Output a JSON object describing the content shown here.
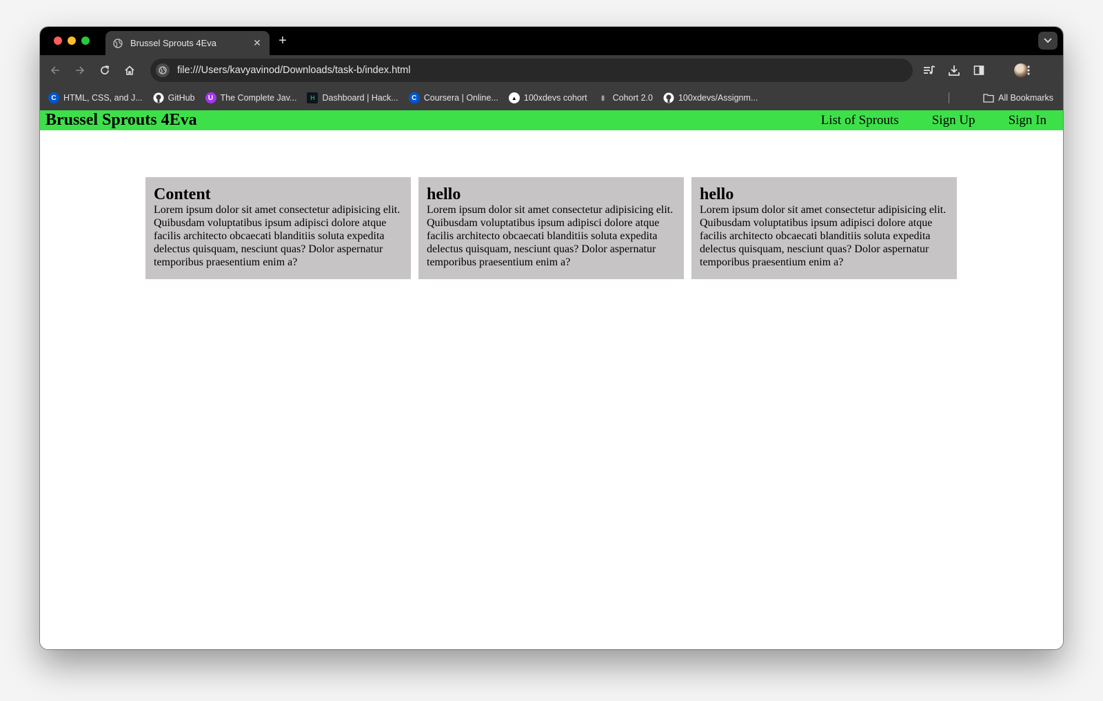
{
  "browser": {
    "tab": {
      "title": "Brussel Sprouts 4Eva"
    },
    "url": "file:///Users/kavyavinod/Downloads/task-b/index.html",
    "bookmarks": [
      {
        "label": "HTML, CSS, and J...",
        "icon": "coursera-icon",
        "color": "#0056d2"
      },
      {
        "label": "GitHub",
        "icon": "github-icon",
        "color": "#ffffff"
      },
      {
        "label": "The Complete Jav...",
        "icon": "udemy-icon",
        "color": "#a435f0"
      },
      {
        "label": "Dashboard | Hack...",
        "icon": "hackerrank-icon",
        "color": "#1ba94c"
      },
      {
        "label": "Coursera | Online...",
        "icon": "coursera-icon",
        "color": "#0056d2"
      },
      {
        "label": "100xdevs cohort",
        "icon": "triangle-icon",
        "color": "#ffffff"
      },
      {
        "label": "Cohort 2.0",
        "icon": "page-icon",
        "color": "#9e9e9e"
      },
      {
        "label": "100xdevs/Assignm...",
        "icon": "github-icon",
        "color": "#ffffff"
      }
    ],
    "all_bookmarks_label": "All Bookmarks"
  },
  "site": {
    "title": "Brussel Sprouts 4Eva",
    "nav": [
      "List of Sprouts",
      "Sign Up",
      "Sign In"
    ],
    "nav_color": "#3ee04a",
    "card_color": "#c6c4c5",
    "cards": [
      {
        "title": "Content",
        "body": "Lorem ipsum dolor sit amet consectetur adipisicing elit. Quibusdam voluptatibus ipsum adipisci dolore atque facilis architecto obcaecati blanditiis soluta expedita delectus quisquam, nesciunt quas? Dolor aspernatur temporibus praesentium enim a?"
      },
      {
        "title": "hello",
        "body": "Lorem ipsum dolor sit amet consectetur adipisicing elit. Quibusdam voluptatibus ipsum adipisci dolore atque facilis architecto obcaecati blanditiis soluta expedita delectus quisquam, nesciunt quas? Dolor aspernatur temporibus praesentium enim a?"
      },
      {
        "title": "hello",
        "body": "Lorem ipsum dolor sit amet consectetur adipisicing elit. Quibusdam voluptatibus ipsum adipisci dolore atque facilis architecto obcaecati blanditiis soluta expedita delectus quisquam, nesciunt quas? Dolor aspernatur temporibus praesentium enim a?"
      }
    ]
  }
}
